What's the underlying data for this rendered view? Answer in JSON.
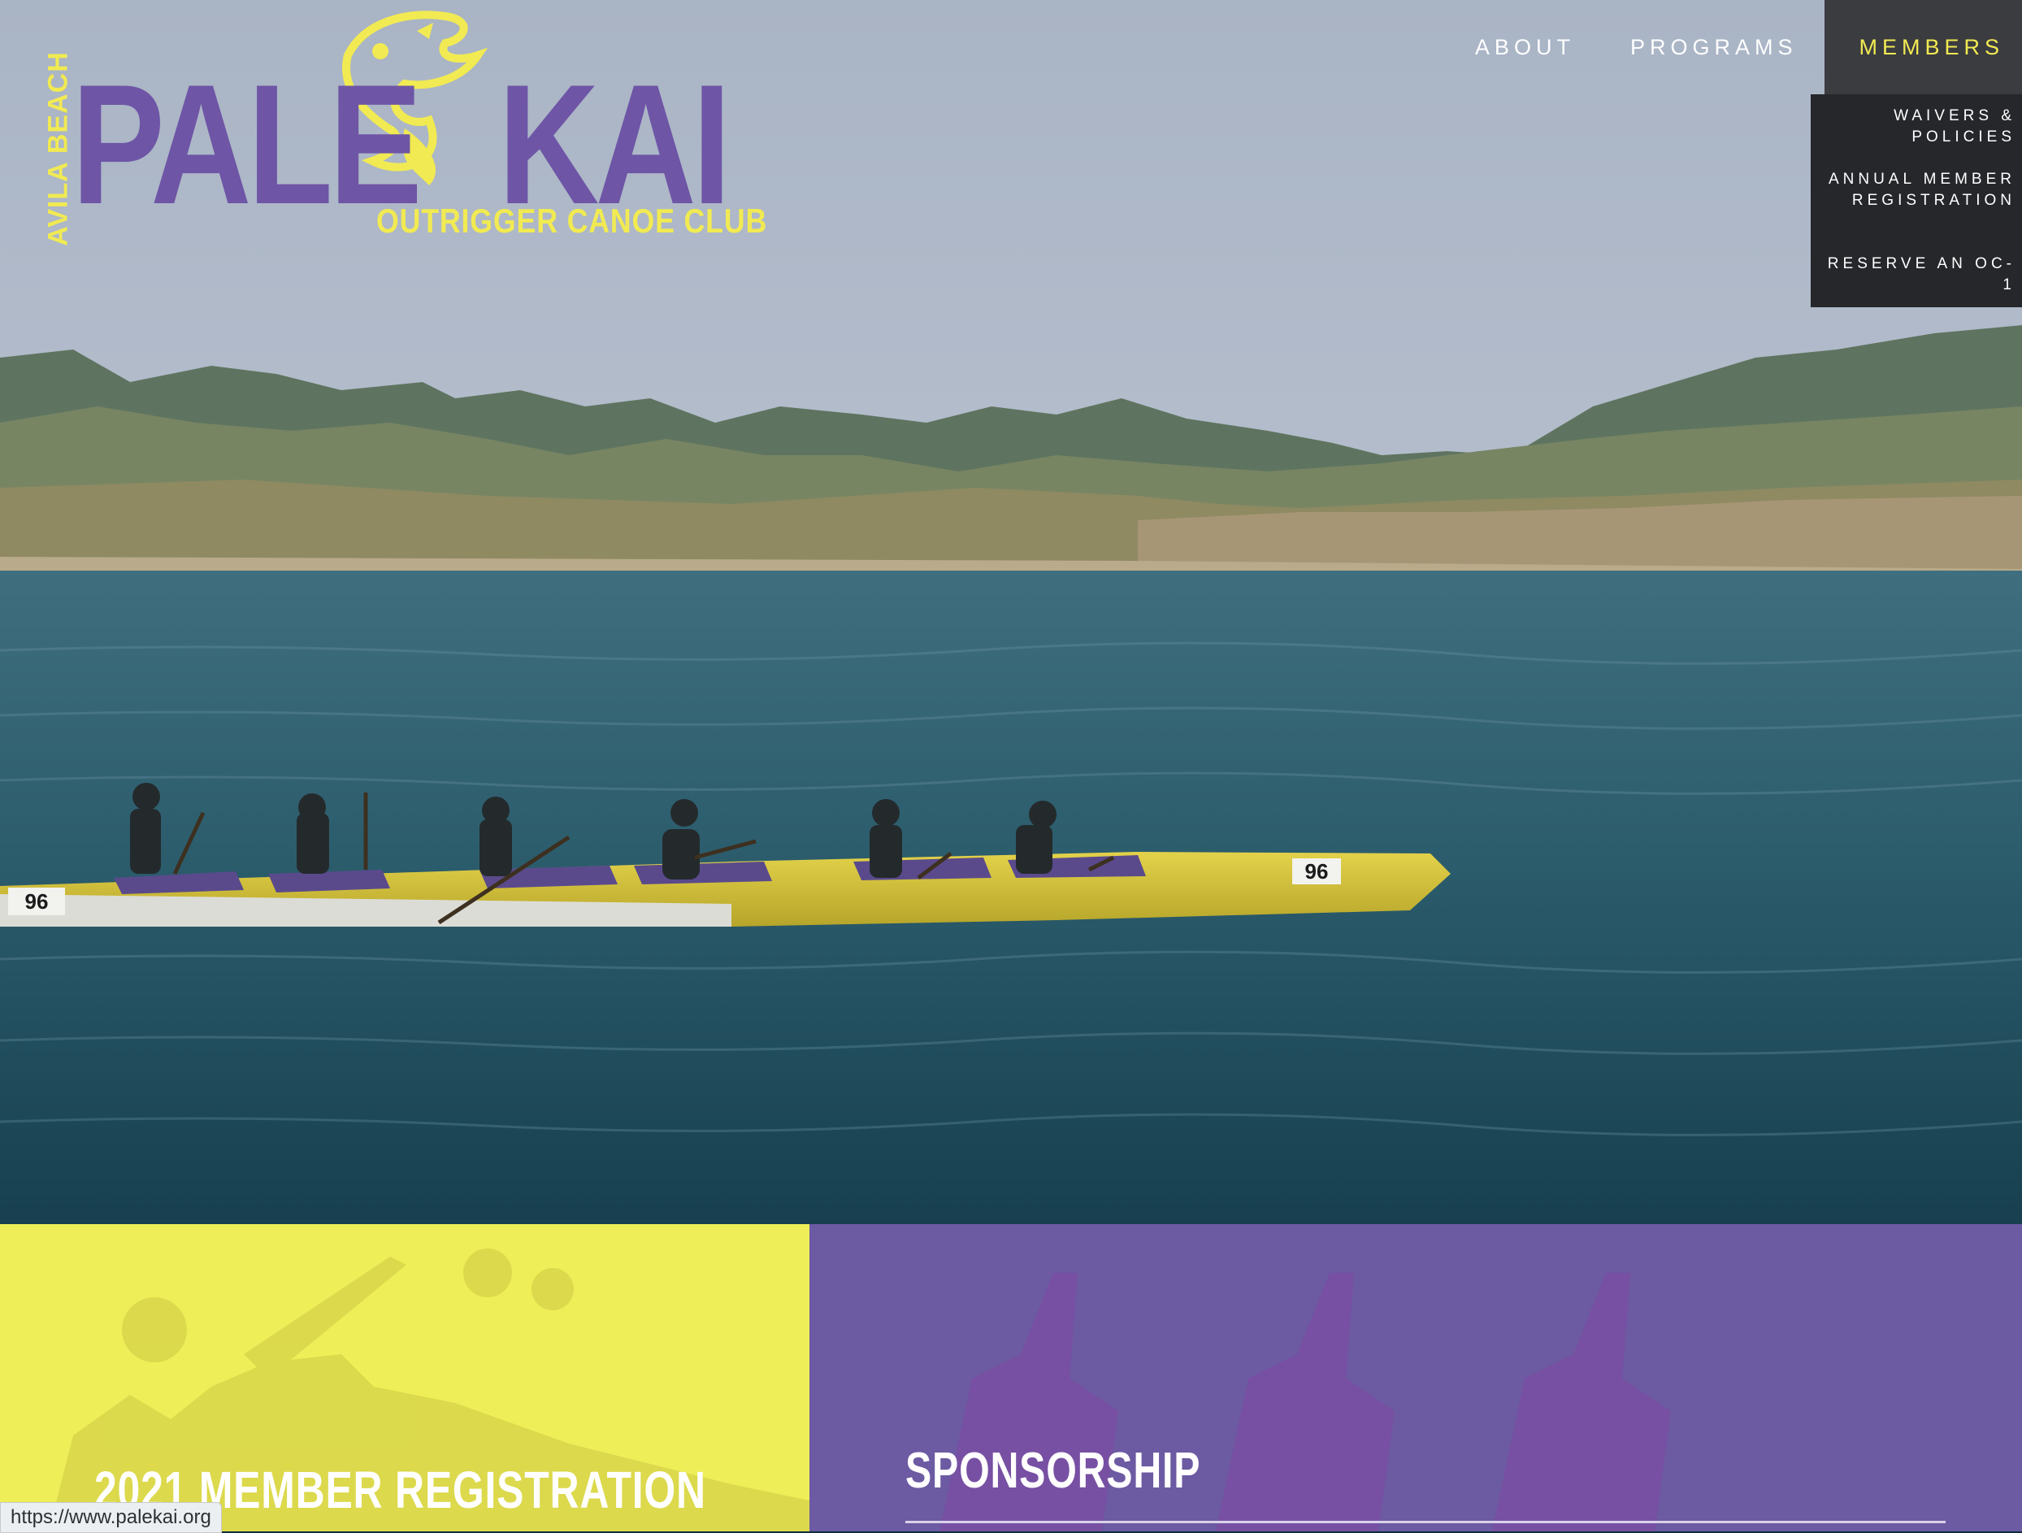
{
  "logo": {
    "side_text": "AVILA BEACH",
    "word_left": "PALE",
    "word_right": "KAI",
    "subtitle": "OUTRIGGER CANOE CLUB"
  },
  "nav": {
    "items": [
      {
        "label": "ABOUT"
      },
      {
        "label": "PROGRAMS"
      },
      {
        "label": "MEMBERS"
      }
    ],
    "active_index": 2,
    "dropdown": [
      {
        "label": "WAIVERS & POLICIES"
      },
      {
        "label": "ANNUAL MEMBER REGISTRATION"
      },
      {
        "label": "RESERVE AN OC-1"
      }
    ]
  },
  "hero": {
    "canoe_numbers": [
      "96",
      "96"
    ]
  },
  "panels": {
    "left_title": "2021 MEMBER REGISTRATION",
    "right_title": "SPONSORSHIP"
  },
  "status_bar": {
    "url": "https://www.palekai.org"
  },
  "colors": {
    "brand_purple": "#6e55a6",
    "brand_yellow": "#f1ea52",
    "dropdown_bg": "#25272b",
    "panel_yellow": "#eeee58",
    "panel_purple": "#6c5aa2"
  }
}
